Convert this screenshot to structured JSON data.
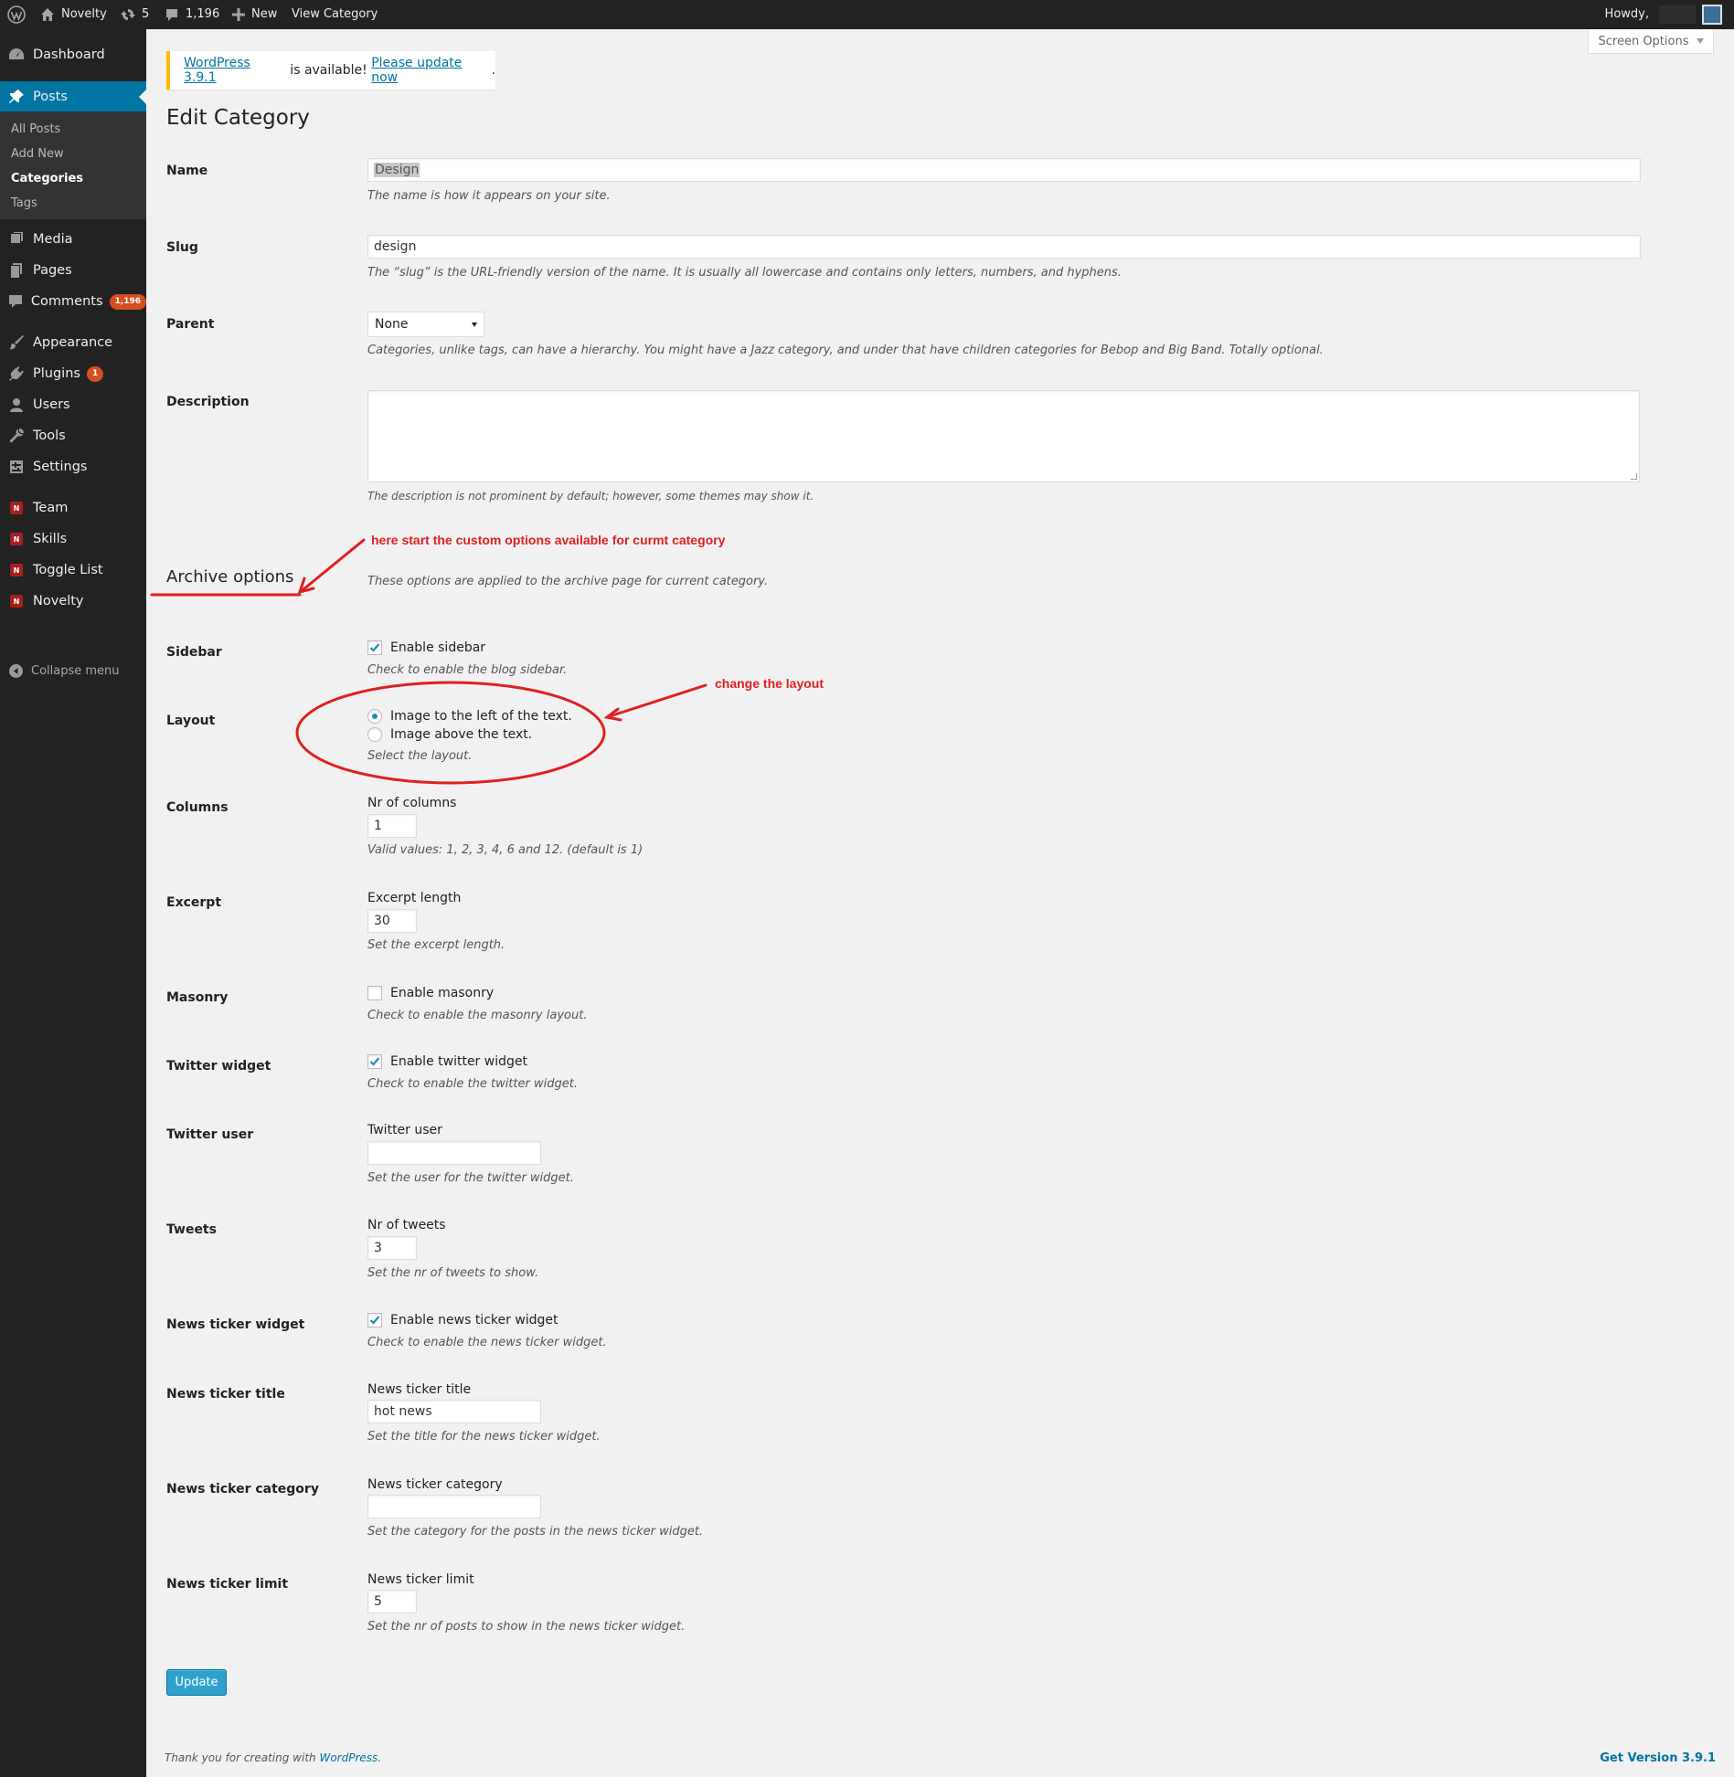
{
  "admin_bar": {
    "site_name": "Novelty",
    "updates_count": "5",
    "comments_count": "1,196",
    "new_label": "New",
    "view_label": "View Category",
    "howdy": "Howdy,"
  },
  "sidebar": {
    "dashboard": "Dashboard",
    "posts": "Posts",
    "posts_sub": [
      "All Posts",
      "Add New",
      "Categories",
      "Tags"
    ],
    "media": "Media",
    "pages": "Pages",
    "comments": "Comments",
    "comments_badge": "1,196",
    "appearance": "Appearance",
    "plugins": "Plugins",
    "plugins_badge": "1",
    "users": "Users",
    "tools": "Tools",
    "settings": "Settings",
    "custom": [
      "Team",
      "Skills",
      "Toggle List",
      "Novelty"
    ],
    "custom_icon_letter": "N",
    "collapse": "Collapse menu"
  },
  "screen_options": "Screen Options",
  "nag": {
    "link1": "WordPress 3.9.1",
    "middle": " is available! ",
    "link2": "Please update now",
    "end": "."
  },
  "page_title": "Edit Category",
  "form": {
    "name_label": "Name",
    "name_value": "Design",
    "name_desc": "The name is how it appears on your site.",
    "slug_label": "Slug",
    "slug_value": "design",
    "slug_desc": "The “slug” is the URL-friendly version of the name. It is usually all lowercase and contains only letters, numbers, and hyphens.",
    "parent_label": "Parent",
    "parent_value": "None",
    "parent_desc": "Categories, unlike tags, can have a hierarchy. You might have a Jazz category, and under that have children categories for Bebop and Big Band. Totally optional.",
    "description_label": "Description",
    "description_desc": "The description is not prominent by default; however, some themes may show it."
  },
  "archive": {
    "heading": "Archive options",
    "desc": "These options are applied to the archive page for current category.",
    "sidebar_label": "Sidebar",
    "sidebar_check": "Enable sidebar",
    "sidebar_checked": true,
    "sidebar_desc": "Check to enable the blog sidebar.",
    "layout_label": "Layout",
    "layout_opt1": "Image to the left of the text.",
    "layout_opt2": "Image above the text.",
    "layout_selected": "Image to the left of the text.",
    "layout_desc": "Select the layout.",
    "columns_label": "Columns",
    "columns_field": "Nr of columns",
    "columns_value": "1",
    "columns_desc": "Valid values: 1, 2, 3, 4, 6 and 12. (default is 1)",
    "excerpt_label": "Excerpt",
    "excerpt_field": "Excerpt length",
    "excerpt_value": "30",
    "excerpt_desc": "Set the excerpt length.",
    "masonry_label": "Masonry",
    "masonry_check": "Enable masonry",
    "masonry_checked": false,
    "masonry_desc": "Check to enable the masonry layout.",
    "twitter_widget_label": "Twitter widget",
    "twitter_widget_check": "Enable twitter widget",
    "twitter_widget_checked": true,
    "twitter_widget_desc": "Check to enable the twitter widget.",
    "twitter_user_label": "Twitter user",
    "twitter_user_field": "Twitter user",
    "twitter_user_value": "",
    "twitter_user_desc": "Set the user for the twitter widget.",
    "tweets_label": "Tweets",
    "tweets_field": "Nr of tweets",
    "tweets_value": "3",
    "tweets_desc": "Set the nr of tweets to show.",
    "ticker_widget_label": "News ticker widget",
    "ticker_widget_check": "Enable news ticker widget",
    "ticker_widget_checked": true,
    "ticker_widget_desc": "Check to enable the news ticker widget.",
    "ticker_title_label": "News ticker title",
    "ticker_title_field": "News ticker title",
    "ticker_title_value": "hot news",
    "ticker_title_desc": "Set the title for the news ticker widget.",
    "ticker_category_label": "News ticker category",
    "ticker_category_field": "News ticker category",
    "ticker_category_value": "",
    "ticker_category_desc": "Set the category for the posts in the news ticker widget.",
    "ticker_limit_label": "News ticker limit",
    "ticker_limit_field": "News ticker limit",
    "ticker_limit_value": "5",
    "ticker_limit_desc": "Set the nr of posts to show in the news ticker widget."
  },
  "update_button": "Update",
  "footer": {
    "thanks": "Thank you for creating with ",
    "wp_link": "WordPress",
    "end": ".",
    "version": "Get Version 3.9.1"
  },
  "annotations": {
    "custom_options": "here start the custom options available for curmt category",
    "change_layout": "change the layout"
  },
  "colors": {
    "admin_bar": "#222222",
    "menu_active": "#0074a2",
    "button_primary": "#2ea2cc",
    "annotation": "#e02020",
    "badge": "#d54e21"
  }
}
